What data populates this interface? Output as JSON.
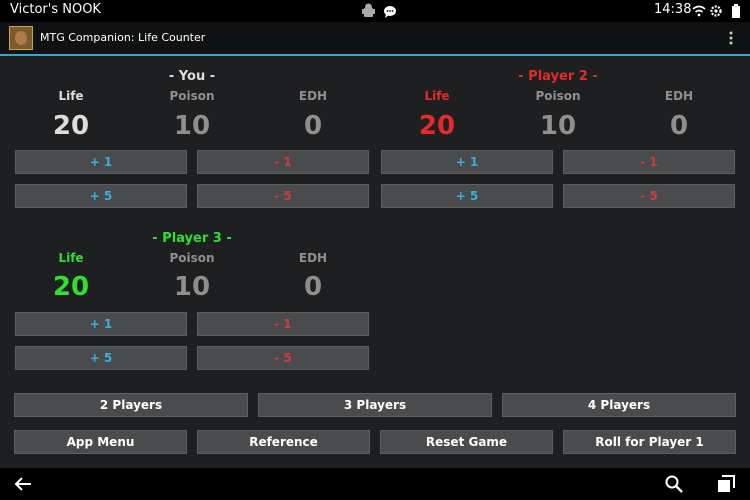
{
  "status": {
    "device_name": "Victor's NOOK",
    "time": "14:38"
  },
  "app": {
    "title": "MTG Companion: Life Counter"
  },
  "players": [
    {
      "name": "- You -",
      "color": "#ffffff",
      "life_label": "Life",
      "poison_label": "Poison",
      "edh_label": "EDH",
      "life": "20",
      "poison": "10",
      "edh": "0",
      "plus1": "+ 1",
      "minus1": "- 1",
      "plus5": "+ 5",
      "minus5": "- 5"
    },
    {
      "name": "- Player 2 -",
      "color": "#e52a2a",
      "life_label": "Life",
      "poison_label": "Poison",
      "edh_label": "EDH",
      "life": "20",
      "poison": "10",
      "edh": "0",
      "plus1": "+ 1",
      "minus1": "- 1",
      "plus5": "+ 5",
      "minus5": "- 5"
    },
    {
      "name": "- Player 3 -",
      "color": "#2fe02f",
      "life_label": "Life",
      "poison_label": "Poison",
      "edh_label": "EDH",
      "life": "20",
      "poison": "10",
      "edh": "0",
      "plus1": "+ 1",
      "minus1": "- 1",
      "plus5": "+ 5",
      "minus5": "- 5"
    }
  ],
  "player_count_buttons": [
    "2 Players",
    "3 Players",
    "4 Players"
  ],
  "actions": [
    "App Menu",
    "Reference",
    "Reset Game",
    "Roll for Player 1"
  ],
  "colors": {
    "accent": "#3aa3cc",
    "plus": "#38b1e0",
    "minus": "#d33b3b",
    "inactive": "#8f8f8f"
  },
  "icons": {
    "notification": [
      "android-debug-icon",
      "chat-icon"
    ],
    "status": [
      "wifi-icon",
      "settings-icon",
      "battery-icon"
    ],
    "nav": [
      "back-icon",
      "search-icon",
      "recent-apps-icon"
    ]
  }
}
